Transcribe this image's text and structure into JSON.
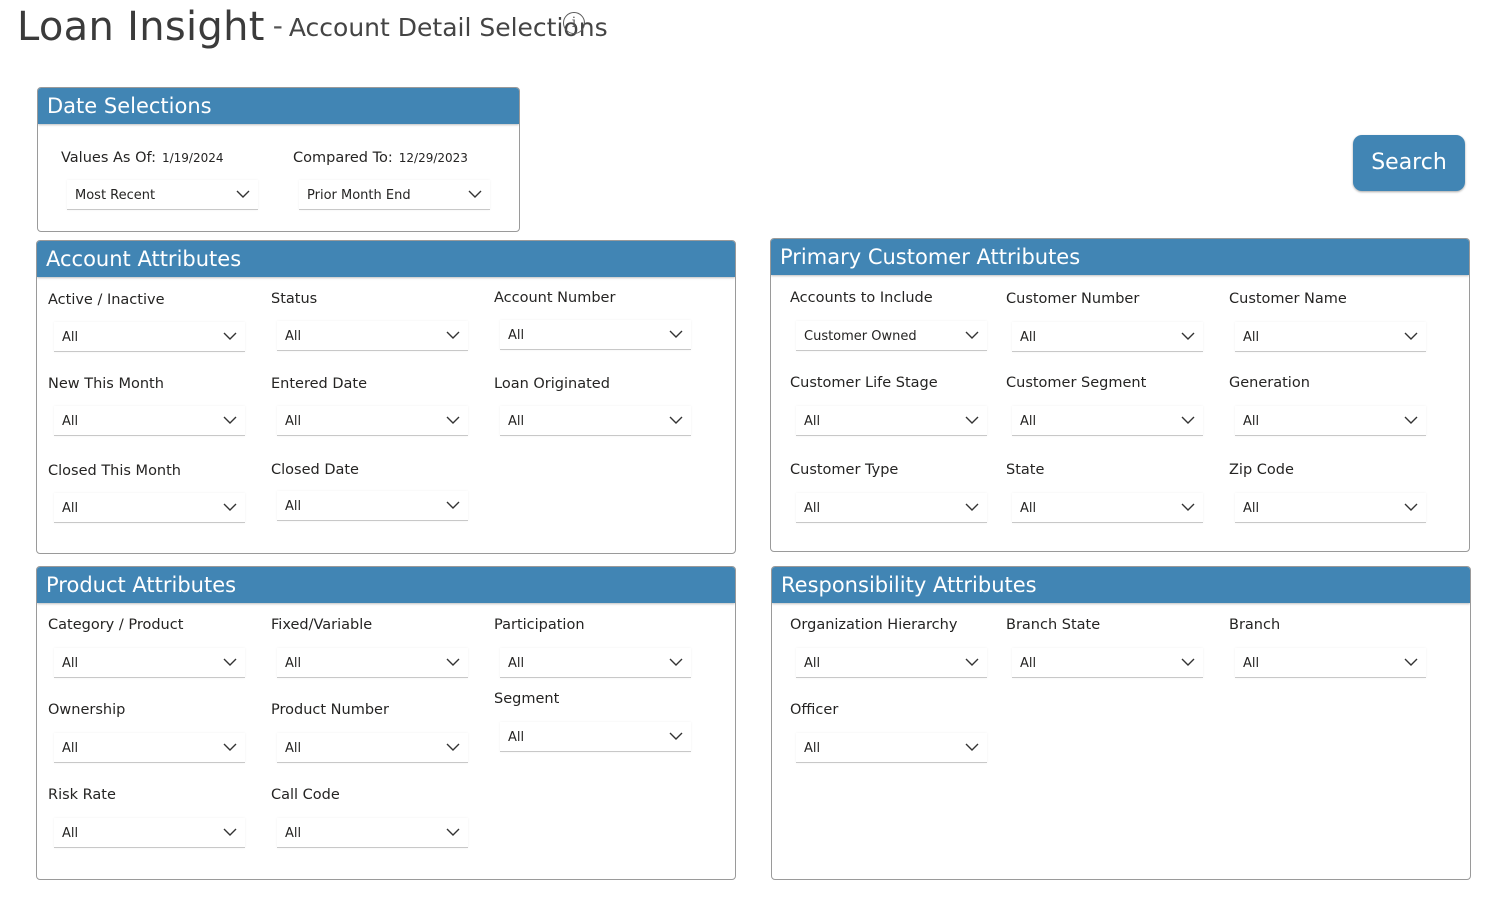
{
  "header": {
    "title": "Loan Insight",
    "separator": "-",
    "subtitle": "Account Detail Selections",
    "info_icon": "info-circle-icon"
  },
  "search_button": {
    "label": "Search"
  },
  "colors": {
    "accent": "#4185b4",
    "panel_border": "#9a9a9a"
  },
  "date_selections": {
    "title": "Date Selections",
    "values_as_of": {
      "label": "Values As Of:",
      "date": "1/19/2024",
      "selected": "Most Recent"
    },
    "compared_to": {
      "label": "Compared To:",
      "date": "12/29/2023",
      "selected": "Prior Month End"
    }
  },
  "account_attributes": {
    "title": "Account Attributes",
    "fields": [
      {
        "label": "Active / Inactive",
        "value": "All"
      },
      {
        "label": "Status",
        "value": "All"
      },
      {
        "label": "Account Number",
        "value": "All"
      },
      {
        "label": "New This Month",
        "value": "All"
      },
      {
        "label": "Entered Date",
        "value": "All"
      },
      {
        "label": "Loan Originated",
        "value": "All"
      },
      {
        "label": "Closed This Month",
        "value": "All"
      },
      {
        "label": "Closed Date",
        "value": "All"
      }
    ]
  },
  "primary_customer_attributes": {
    "title": "Primary Customer Attributes",
    "fields": [
      {
        "label": "Accounts to Include",
        "value": "Customer Owned"
      },
      {
        "label": "Customer Number",
        "value": "All"
      },
      {
        "label": "Customer Name",
        "value": "All"
      },
      {
        "label": "Customer Life Stage",
        "value": "All"
      },
      {
        "label": "Customer Segment",
        "value": "All"
      },
      {
        "label": "Generation",
        "value": "All"
      },
      {
        "label": "Customer Type",
        "value": "All"
      },
      {
        "label": "State",
        "value": "All"
      },
      {
        "label": "Zip Code",
        "value": "All"
      }
    ]
  },
  "product_attributes": {
    "title": "Product Attributes",
    "fields": [
      {
        "label": "Category / Product",
        "value": "All"
      },
      {
        "label": "Fixed/Variable",
        "value": "All"
      },
      {
        "label": "Participation",
        "value": "All"
      },
      {
        "label": "Ownership",
        "value": "All"
      },
      {
        "label": "Product Number",
        "value": "All"
      },
      {
        "label": "Segment",
        "value": "All"
      },
      {
        "label": "Risk Rate",
        "value": "All"
      },
      {
        "label": "Call Code",
        "value": "All"
      }
    ]
  },
  "responsibility_attributes": {
    "title": "Responsibility Attributes",
    "fields": [
      {
        "label": "Organization Hierarchy",
        "value": "All"
      },
      {
        "label": "Branch State",
        "value": "All"
      },
      {
        "label": "Branch",
        "value": "All"
      },
      {
        "label": "Officer",
        "value": "All"
      }
    ]
  }
}
